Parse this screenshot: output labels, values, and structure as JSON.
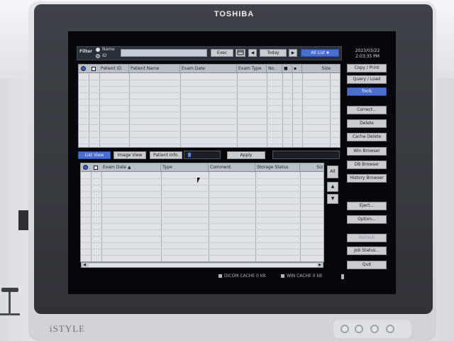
{
  "monitor": {
    "brand": "TOSHIBA",
    "model": "iSTYLE"
  },
  "filter": {
    "label": "Filter",
    "radio_name": "Name",
    "radio_id": "ID",
    "exec": "Exec",
    "today": "Today",
    "all_list": "All List"
  },
  "datetime": {
    "date": "2023/03/22",
    "time": "2:03:35 PM"
  },
  "top_table": {
    "columns": [
      "Patient ID",
      "Patient Name",
      "Exam Date",
      "Exam Type",
      "No..",
      "Size"
    ]
  },
  "tabs": {
    "list_view": "List View",
    "image_view": "Image View",
    "patient_info": "Patient Info.",
    "apply": "Apply"
  },
  "bottom_table": {
    "columns": [
      "Exam Date",
      "Type",
      "Comment",
      "Storage Status",
      "Siz"
    ]
  },
  "side": {
    "all": "All",
    "up": "▲",
    "down": "▼"
  },
  "right_buttons": {
    "copy_print": "Copy / Print",
    "query_load": "Query / Load",
    "tools": "Tools",
    "correct": "Correct...",
    "delete": "Delete",
    "cache_delete": "Cache Delete",
    "win_browser": "Win Browser",
    "db_browser": "DB Browser",
    "history_browser": "History Browser",
    "eject": "Eject...",
    "option": "Option...",
    "refresh": "Refresh",
    "job_status": "Job Status...",
    "quit": "Quit"
  },
  "status": {
    "dicom_cache": "DICOM CACHE 0 kB",
    "win_cache": "WIN CACHE 0 kB"
  }
}
